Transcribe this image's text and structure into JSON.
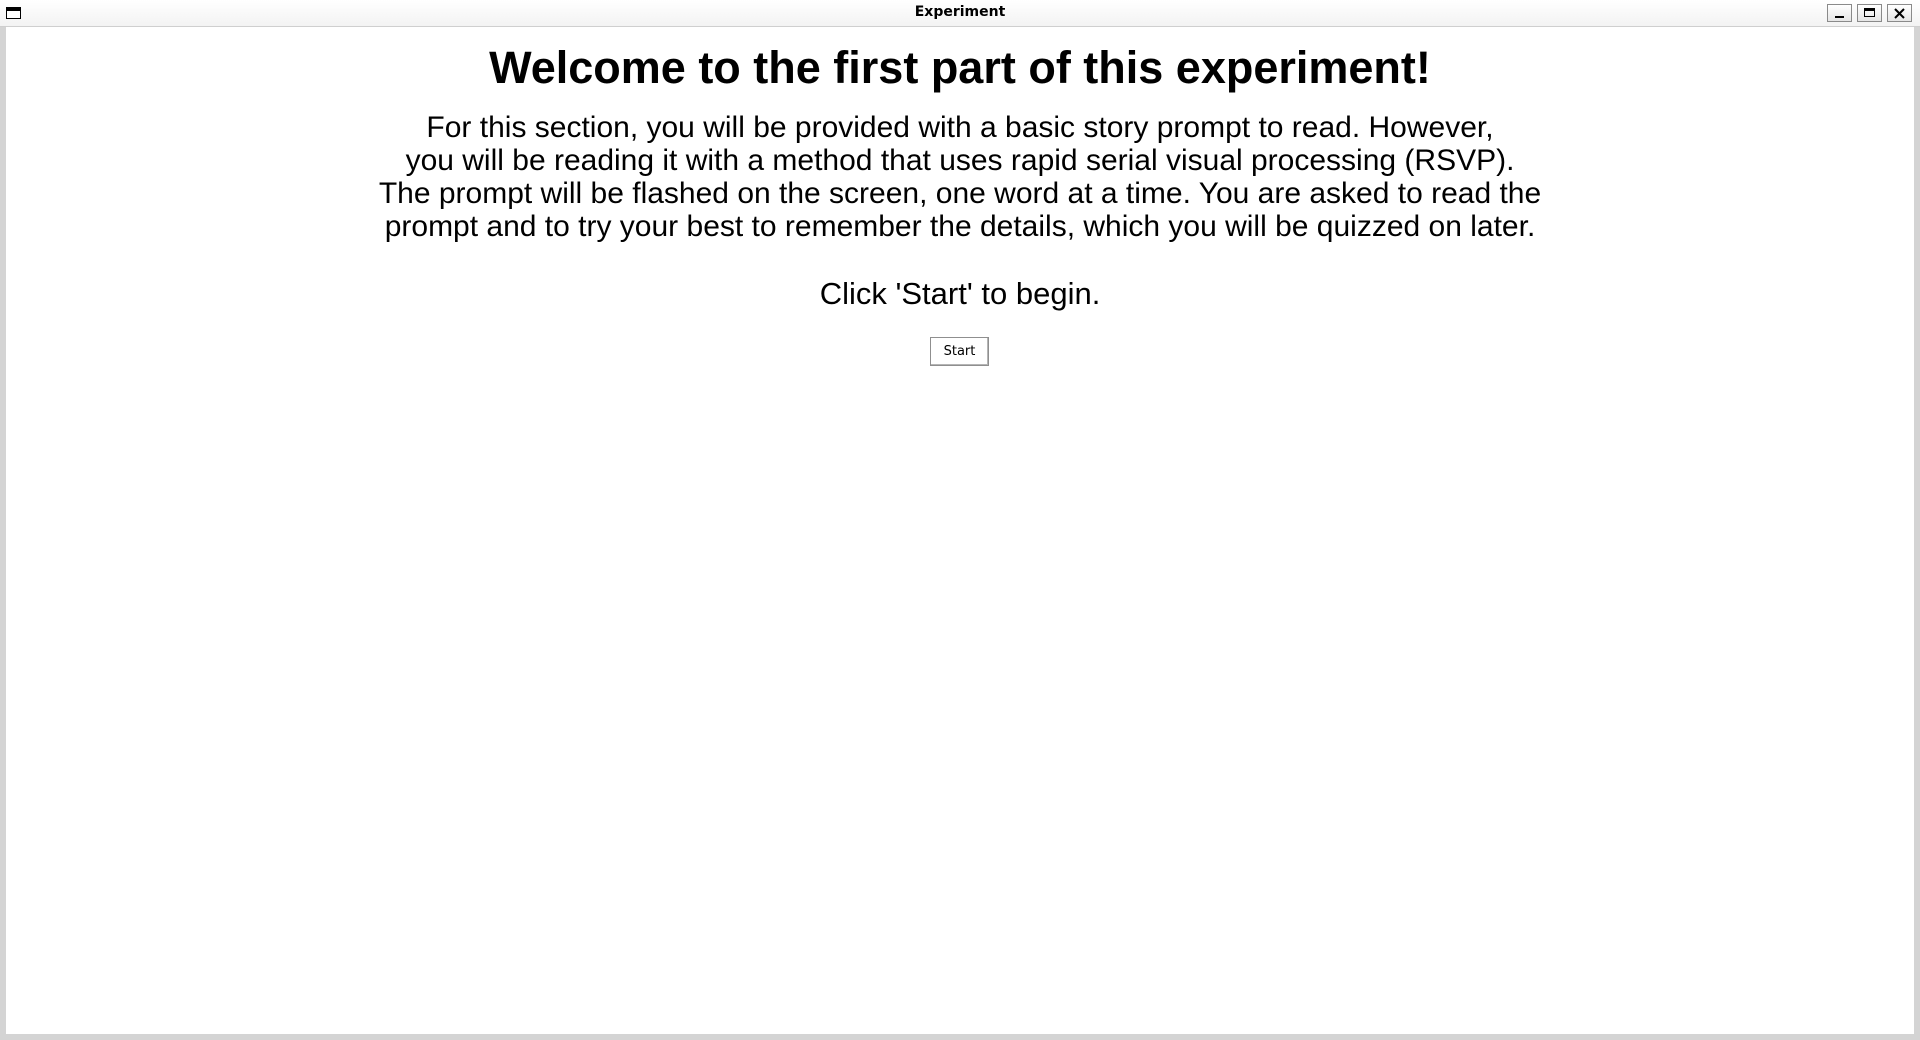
{
  "window": {
    "title": "Experiment",
    "controls": {
      "minimize": "minimize-icon",
      "maximize": "maximize-icon",
      "close": "close-icon"
    }
  },
  "content": {
    "heading": "Welcome to the first part of this experiment!",
    "paragraph_lines": [
      "For this section, you will be provided with a basic story prompt to read. However,",
      "you will be reading it with a method that uses rapid serial visual processing (RSVP).",
      "The prompt will be flashed on the screen, one word at a time. You are asked to read the",
      "prompt and to try your best to remember the details, which you will be quizzed on later."
    ],
    "instruction": "Click 'Start' to begin.",
    "start_button_label": "Start"
  }
}
